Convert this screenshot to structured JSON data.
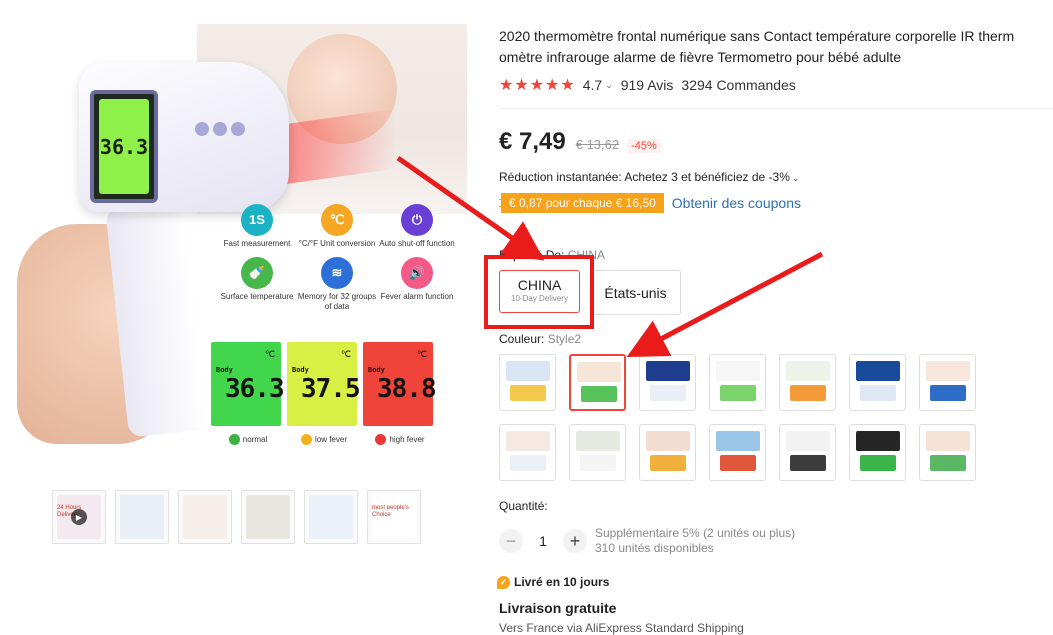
{
  "gallery": {
    "device_reading": "36.3",
    "features": [
      {
        "icon": "1s-speed-icon",
        "icon_text": "1S",
        "color": "#1ab3c6",
        "label": "Fast measurement"
      },
      {
        "icon": "thermometer-icon",
        "icon_text": "℃",
        "color": "#f5a623",
        "label": "°C/°F Unit conversion"
      },
      {
        "icon": "power-icon",
        "icon_text": "⏻",
        "color": "#6a3fd6",
        "label": "Auto shut-off function"
      },
      {
        "icon": "bottle-icon",
        "icon_text": "🍼",
        "color": "#46b84a",
        "label": "Surface temperature"
      },
      {
        "icon": "layers-icon",
        "icon_text": "≋",
        "color": "#2d6fd8",
        "label": "Memory for 32 groups of data"
      },
      {
        "icon": "speaker-icon",
        "icon_text": "🔊",
        "color": "#f35a88",
        "label": "Fever alarm function"
      }
    ],
    "lcd_readings": [
      {
        "value": "36.3",
        "label": "normal",
        "color": "#41d64c",
        "face_color": "#3cb043"
      },
      {
        "value": "37.5",
        "label": "low fever",
        "color": "#d7f043",
        "face_color": "#f2b21c"
      },
      {
        "value": "38.8",
        "label": "high fever",
        "color": "#f0433a",
        "face_color": "#e53935"
      }
    ],
    "lcd_body_label": "Body",
    "lcd_unit": "℃",
    "thumbnails": [
      {
        "type": "video",
        "text": "24 Hours Delivery"
      },
      {
        "type": "image",
        "text": ""
      },
      {
        "type": "image",
        "text": ""
      },
      {
        "type": "image",
        "text": ""
      },
      {
        "type": "image",
        "text": ""
      },
      {
        "type": "image",
        "text": "most people's Choice"
      }
    ]
  },
  "product": {
    "title_line1": "2020 thermomètre frontal numérique sans Contact température corporelle IR therm",
    "title_line2": "omètre infrarouge alarme de fièvre Termometro pour bébé adulte",
    "rating": "4.7",
    "stars": "★★★★★",
    "reviews": "919 Avis",
    "orders": "3294 Commandes",
    "price": "€ 7,49",
    "old_price": "€ 13,62",
    "discount": "-45%",
    "instant_discount": "Réduction instantanée: Achetez 3 et bénéficiez de -3%",
    "coupon_tag": "€ 0,87 pour chaque € 16,50",
    "coupon_link": "Obtenir des coupons",
    "ship_from_label": "Expédié De:",
    "ship_from_value": "CHINA",
    "ship_options": [
      {
        "name": "CHINA",
        "sub": "10-Day Delivery",
        "selected": true
      },
      {
        "name": "États-unis",
        "sub": "",
        "selected": false
      }
    ],
    "color_label": "Couleur:",
    "color_value": "Style2",
    "swatches": [
      {
        "c1": "#d9e6f5",
        "c2": "#f2c94c"
      },
      {
        "c1": "#f5e6d8",
        "c2": "#57c25a",
        "selected": true
      },
      {
        "c1": "#1e3d8f",
        "c2": "#e9eef7"
      },
      {
        "c1": "#f6f6f6",
        "c2": "#7bd36b"
      },
      {
        "c1": "#eef3ea",
        "c2": "#f29b38"
      },
      {
        "c1": "#1a4a9c",
        "c2": "#dfe8f5"
      },
      {
        "c1": "#f7e6dc",
        "c2": "#2f6cc6"
      },
      {
        "c1": "#f6e9e2",
        "c2": "#ebf1f7"
      },
      {
        "c1": "#e6e8e2",
        "c2": "#f4f4f4"
      },
      {
        "c1": "#f3ddd0",
        "c2": "#f2b13c"
      },
      {
        "c1": "#9cc6e8",
        "c2": "#e0573c"
      },
      {
        "c1": "#f2f2f2",
        "c2": "#3c3c3c"
      },
      {
        "c1": "#262626",
        "c2": "#3bb54a"
      },
      {
        "c1": "#f6e3d6",
        "c2": "#5ab865"
      }
    ],
    "quantity_label": "Quantité:",
    "quantity": "1",
    "qty_minus": "−",
    "qty_plus": "+",
    "extra_discount": "Supplémentaire 5% (2 unités ou plus)",
    "available": "310 unités disponibles",
    "delivery_badge": "Livré en 10 jours",
    "free_shipping": "Livraison gratuite",
    "shipping_detail": "Vers France via AliExpress Standard Shipping"
  },
  "colors": {
    "accent": "#f0453a",
    "coupon": "#f7a21b",
    "link": "#2f6fb5",
    "annotation": "#ea1b1b"
  }
}
